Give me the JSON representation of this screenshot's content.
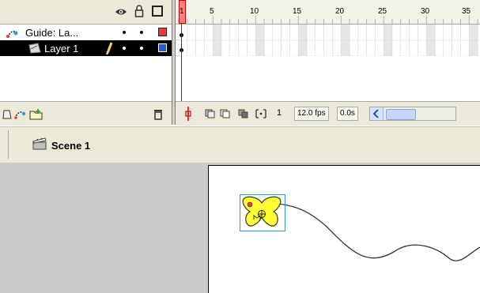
{
  "timeline": {
    "ruler_labels": [
      "1",
      "5",
      "10",
      "15",
      "20",
      "25",
      "30",
      "35"
    ],
    "layers": [
      {
        "name": "Guide: La...",
        "color": "#e83c3c",
        "selected": false
      },
      {
        "name": "Layer 1",
        "color": "#2a5bd7",
        "selected": true
      }
    ],
    "footer": {
      "current_frame": "1",
      "frame_rate": "12.0 fps",
      "elapsed_time": "0.0s"
    }
  },
  "scene": {
    "label": "Scene 1"
  },
  "icons": {
    "eye": "eye-icon",
    "lock": "lock-icon",
    "outline": "outline-icon",
    "guide": "motion-guide-icon",
    "layer": "layer-icon",
    "pencil": "pencil-icon",
    "trash": "trash-icon",
    "scene": "clapper-icon",
    "symbol": "butterfly-symbol"
  },
  "colors": {
    "accent_red": "#e83c3c",
    "selection_black": "#000000",
    "layer_blue": "#2a5bd7",
    "symbol_yellow": "#ffff33"
  }
}
